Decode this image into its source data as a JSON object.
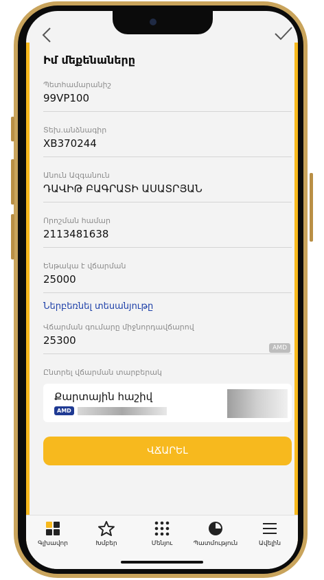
{
  "header": {
    "title": "Իմ մեքենաները"
  },
  "fields": [
    {
      "label": "Պետհամարանիշ",
      "value": "99VP100"
    },
    {
      "label": "Տեխ.անձնագիր",
      "value": "XB370244"
    },
    {
      "label": "Անուն Ազգանուն",
      "value": "ԴԱՎԻԹ ԲԱԳՐԱՏԻ ԱՍԱՏՐՅԱՆ"
    },
    {
      "label": "Որոշման համար",
      "value": "2113481638"
    },
    {
      "label": "Ենթակա է վճարման",
      "value": "25000"
    }
  ],
  "link": {
    "label": "Ներբեռնել տեսանյութը"
  },
  "total": {
    "label": "Վճարման գումարը միջնորդավճարով",
    "value": "25300",
    "currency": "AMD"
  },
  "payment": {
    "select_label": "Ընտրել վճարման տարբերակ",
    "card_title": "Քարտային հաշիվ",
    "currency": "AMD"
  },
  "pay_button": {
    "label": "ՎՃԱՐԵԼ"
  },
  "tabbar": [
    {
      "label": "Գլխավոր",
      "icon": "home-grid-icon"
    },
    {
      "label": "Խմբեր",
      "icon": "star-icon"
    },
    {
      "label": "Մենյու",
      "icon": "dots-grid-icon"
    },
    {
      "label": "Պատմություն",
      "icon": "history-pie-icon"
    },
    {
      "label": "Ավելին",
      "icon": "hamburger-icon"
    }
  ],
  "colors": {
    "accent": "#f7b91e",
    "link": "#1c3fa8",
    "chip": "#1f3a93"
  }
}
